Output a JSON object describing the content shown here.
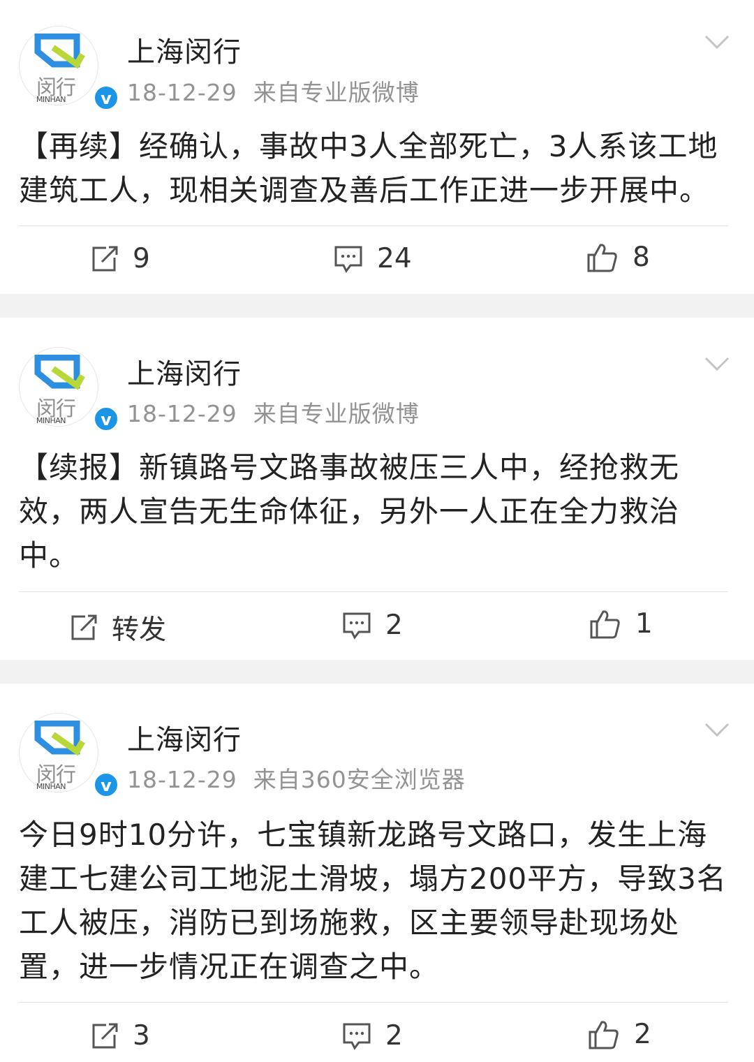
{
  "account": {
    "name": "上海闵行",
    "avatar_text": "闵行",
    "avatar_sub": "MINHAN"
  },
  "posts": [
    {
      "date": "18-12-29",
      "source": "来自专业版微博",
      "text": "【再续】经确认，事故中3人全部死亡，3人系该工地建筑工人，现相关调查及善后工作正进一步开展中。",
      "repost": "9",
      "comments": "24",
      "likes": "8"
    },
    {
      "date": "18-12-29",
      "source": "来自专业版微博",
      "text": "【续报】新镇路号文路事故被压三人中，经抢救无效，两人宣告无生命体征，另外一人正在全力救治中。",
      "repost": "转发",
      "comments": "2",
      "likes": "1"
    },
    {
      "date": "18-12-29",
      "source": "来自360安全浏览器",
      "text": "今日9时10分许，七宝镇新龙路号文路口，发生上海建工七建公司工地泥土滑坡，塌方200平方，导致3名工人被压，消防已到场施救，区主要领导赴现场处置，进一步情况正在调查之中。",
      "repost": "3",
      "comments": "2",
      "likes": "2"
    }
  ],
  "colors": {
    "verified_badge": "#1b95e8",
    "logo_blue": "#2e8fe0",
    "logo_green": "#b8d83a",
    "page_bg": "#f2f2f2"
  },
  "icons": {
    "repost": "repost-icon",
    "comment": "comment-icon",
    "like": "like-icon",
    "more": "chevron-down-icon",
    "verified": "verified-badge-icon"
  }
}
